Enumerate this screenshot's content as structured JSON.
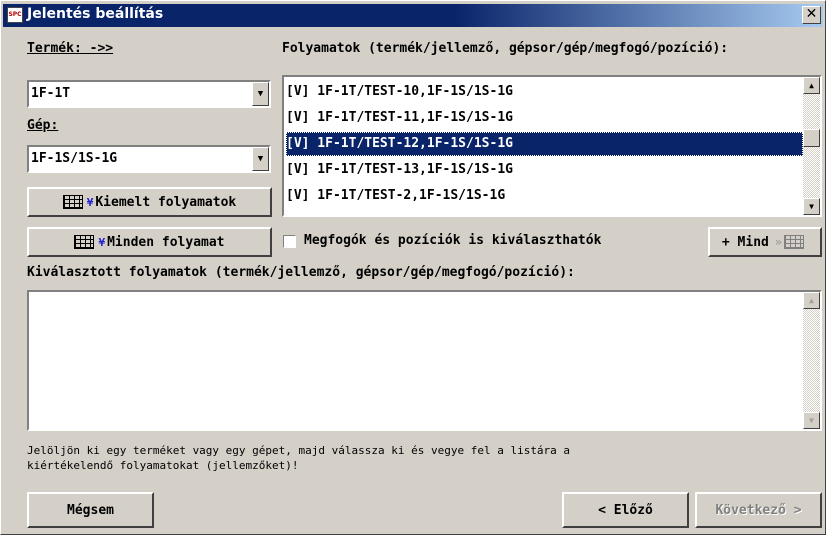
{
  "window": {
    "title": "Jelentés beállítás",
    "app_icon_text": "SPC"
  },
  "product": {
    "label": "Termék: ->>",
    "value": "1F-1T"
  },
  "machine": {
    "label": "Gép:",
    "value": "1F-1S/1S-1G"
  },
  "buttons": {
    "highlighted": "Kiemelt folyamatok",
    "all": "Minden folyamat",
    "add_all": "+ Mind",
    "cancel": "Mégsem",
    "prev": "< Előző",
    "next": "Következő >"
  },
  "processes": {
    "label": "Folyamatok (termék/jellemző, gépsor/gép/megfogó/pozíció):",
    "items": [
      "[V] 1F-1T/TEST-10,1F-1S/1S-1G",
      "[V] 1F-1T/TEST-11,1F-1S/1S-1G",
      "[V] 1F-1T/TEST-12,1F-1S/1S-1G",
      "[V] 1F-1T/TEST-13,1F-1S/1S-1G",
      "[V] 1F-1T/TEST-2,1F-1S/1S-1G"
    ],
    "selected_index": 2
  },
  "grippers_checkbox": {
    "label": "Megfogók és pozíciók is kiválaszthatók",
    "checked": false
  },
  "selected": {
    "label": "Kiválasztott folyamatok (termék/jellemző, gépsor/gép/megfogó/pozíció):",
    "items": []
  },
  "hint": "Jelöljön ki egy terméket vagy egy gépet, majd válassza ki és vegye fel a listára a\nkiértékelendő folyamatokat (jellemzőket)!",
  "icons": {
    "app": "spc-app-icon",
    "close": "close-icon",
    "dropdown": "dropdown-arrow-icon",
    "list_add": "list-add-icon",
    "list_move": "list-move-icon",
    "scroll_up": "scroll-up-icon",
    "scroll_down": "scroll-down-icon"
  },
  "colors": {
    "titlebar": "#0a246a",
    "selection": "#0a246a",
    "face": "#d4d0c8",
    "chevron": "#2020d0"
  }
}
